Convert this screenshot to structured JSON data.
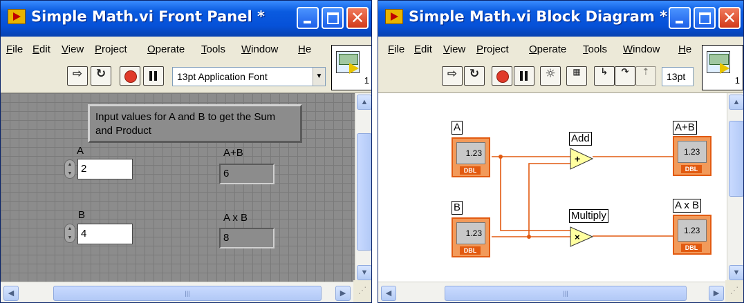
{
  "front_panel": {
    "title": "Simple Math.vi Front Panel *",
    "menu": [
      "File",
      "Edit",
      "View",
      "Project",
      "Operate",
      "Tools",
      "Window",
      "He"
    ],
    "font_selector": "13pt Application Font",
    "connector_number": "1",
    "note": "Input values for A and B to get the Sum and Product",
    "control_a": {
      "label": "A",
      "value": "2"
    },
    "control_b": {
      "label": "B",
      "value": "4"
    },
    "indicator_sum": {
      "label": "A+B",
      "value": "6"
    },
    "indicator_product": {
      "label": "A x B",
      "value": "8"
    }
  },
  "block_diagram": {
    "title": "Simple Math.vi Block Diagram *",
    "menu": [
      "File",
      "Edit",
      "View",
      "Project",
      "Operate",
      "Tools",
      "Window",
      "He"
    ],
    "font_selector": "13pt",
    "connector_number": "1",
    "term_a": {
      "label": "A",
      "value": "1.23",
      "type": "DBL"
    },
    "term_b": {
      "label": "B",
      "value": "1.23",
      "type": "DBL"
    },
    "add_node": {
      "label": "Add",
      "symbol": "+"
    },
    "multiply_node": {
      "label": "Multiply",
      "symbol": "×"
    },
    "term_sum": {
      "label": "A+B",
      "value": "1.23",
      "type": "DBL"
    },
    "term_product": {
      "label": "A x B",
      "value": "1.23",
      "type": "DBL"
    }
  },
  "colors": {
    "wire": "#e25a10",
    "titlebar": "#0651d8",
    "canvas": "#8c8c8c"
  }
}
